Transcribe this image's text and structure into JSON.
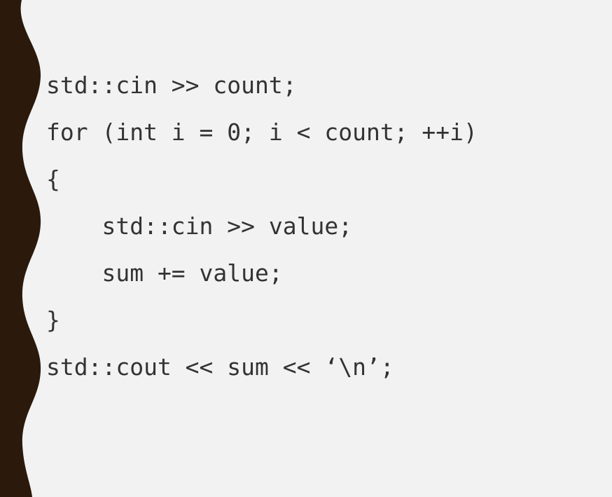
{
  "code": {
    "lines": [
      "std::cin >> count;",
      "for (int i = 0; i < count; ++i)",
      "{",
      "    std::cin >> value;",
      "    sum += value;",
      "}",
      "std::cout << sum << ‘\\n’;"
    ]
  },
  "colors": {
    "background": "#f2f2f2",
    "edge": "#2b1a0c",
    "text": "#333333"
  }
}
